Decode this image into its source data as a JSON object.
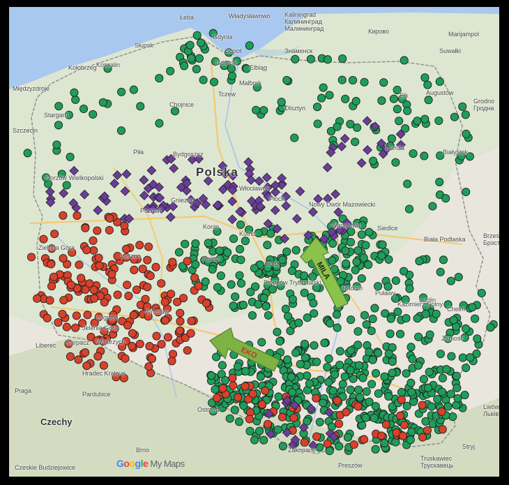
{
  "map": {
    "country_label": "Polska",
    "neighbor_labels": [
      "Czechy"
    ],
    "logo": {
      "part1": "G",
      "part2": "o",
      "part3": "o",
      "part4": "g",
      "part5": "l",
      "part6": "e",
      "suffix": " My Maps"
    },
    "arrows": [
      {
        "label": "MILA",
        "color": "#8bc34a"
      },
      {
        "label": "EKO",
        "color": "#7cb342"
      }
    ],
    "marker_colors": {
      "green": "#1e9e5a",
      "red": "#d9412b",
      "purple": "#6a3d9a"
    },
    "cities": [
      {
        "name": "Kaliningrad"
      },
      {
        "name": "Калининград"
      },
      {
        "name": "Gdynia"
      },
      {
        "name": "Sopot"
      },
      {
        "name": "Gdańsk"
      },
      {
        "name": "Elbląg"
      },
      {
        "name": "Słupsk"
      },
      {
        "name": "Koszalin"
      },
      {
        "name": "Kołobrzeg"
      },
      {
        "name": "Szczecin"
      },
      {
        "name": "Olsztyn"
      },
      {
        "name": "Ełk"
      },
      {
        "name": "Suwałki"
      },
      {
        "name": "Augustów"
      },
      {
        "name": "Grodno"
      },
      {
        "name": "Гродна"
      },
      {
        "name": "Białystok"
      },
      {
        "name": "Łomża"
      },
      {
        "name": "Bydgoszcz"
      },
      {
        "name": "Piła"
      },
      {
        "name": "Gorzów Wielkopolski"
      },
      {
        "name": "Poznań"
      },
      {
        "name": "Gniezno"
      },
      {
        "name": "Włocławek"
      },
      {
        "name": "Płock"
      },
      {
        "name": "Konin"
      },
      {
        "name": "Kutno"
      },
      {
        "name": "Łódź"
      },
      {
        "name": "Kalisz"
      },
      {
        "name": "Leszno"
      },
      {
        "name": "Zielona Góra"
      },
      {
        "name": "Nowy Dwór Mazowiecki"
      },
      {
        "name": "Warszawa"
      },
      {
        "name": "Siedlce"
      },
      {
        "name": "Biała Podlaska"
      },
      {
        "name": "Brześć"
      },
      {
        "name": "Брэст"
      },
      {
        "name": "Radom"
      },
      {
        "name": "Puławy"
      },
      {
        "name": "Lublin"
      },
      {
        "name": "Chełm"
      },
      {
        "name": "Kazimierz Dolny"
      },
      {
        "name": "Zamość"
      },
      {
        "name": "Piotrków Trybunalski"
      },
      {
        "name": "Wrocław"
      },
      {
        "name": "Legnica"
      },
      {
        "name": "Jelenia Góra"
      },
      {
        "name": "Wałbrzych"
      },
      {
        "name": "Liberec"
      },
      {
        "name": "Hradec Kralove"
      },
      {
        "name": "Pardubice"
      },
      {
        "name": "Praga"
      },
      {
        "name": "Ostrava"
      },
      {
        "name": "Brno"
      },
      {
        "name": "Zakopane"
      },
      {
        "name": "Preszów"
      },
      {
        "name": "Lwów"
      },
      {
        "name": "Львів"
      },
      {
        "name": "Stryj"
      },
      {
        "name": "Truskawiec"
      },
      {
        "name": "Трускавець"
      },
      {
        "name": "Marijampol"
      },
      {
        "name": "Кирово"
      },
      {
        "name": "Знаменск"
      },
      {
        "name": "Малининград"
      },
      {
        "name": "Międzyzdroje"
      },
      {
        "name": "Stargard"
      },
      {
        "name": "Chojnice"
      },
      {
        "name": "Malbork"
      },
      {
        "name": "Władysławowo"
      },
      {
        "name": "Łeba"
      },
      {
        "name": "Czeskie Budziejowice"
      },
      {
        "name": "Karpacz"
      },
      {
        "name": "Tczew"
      }
    ]
  }
}
